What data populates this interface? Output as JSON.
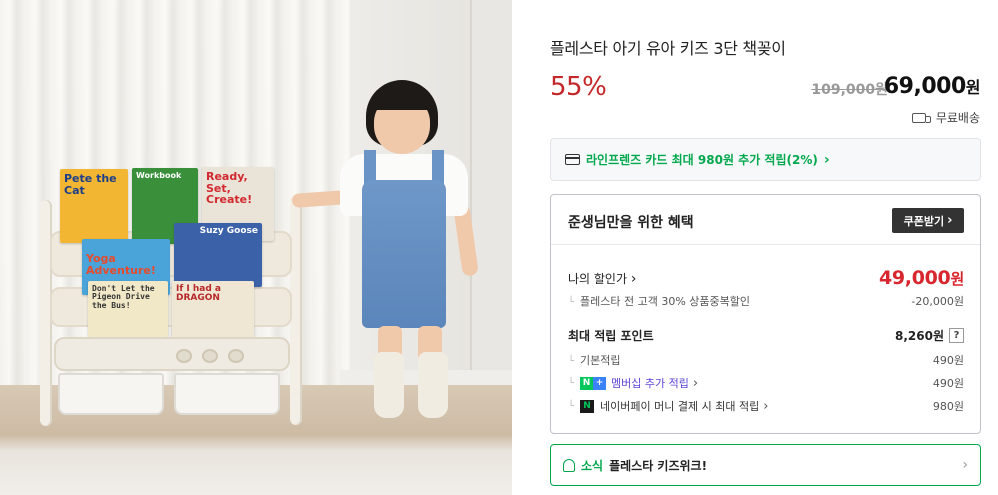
{
  "product": {
    "title": "플레스타 아기 유아 키즈 3단 책꽂이",
    "discount_rate": "55%",
    "original_price": "109,000원",
    "sale_price_number": "69,000",
    "sale_price_unit": "원",
    "shipping": "무료배송",
    "icons": {
      "shipping": "truck-icon"
    }
  },
  "card_promo": {
    "text": "라인프렌즈 카드 최대 980원 추가 적립(2%)",
    "chevron": "›",
    "icon": "credit-card-icon",
    "color": "#03a84e"
  },
  "benefit": {
    "title": "준생님만을 위한 혜택",
    "coupon_button": "쿠폰받기",
    "coupon_chevron": "›",
    "my_discount_label": "나의 할인가",
    "my_discount_chevron": "›",
    "my_discount_price_number": "49,000",
    "my_discount_price_unit": "원",
    "my_discount_detail_label": "플레스타 전 고객 30% 상품중복할인",
    "my_discount_detail_value": "-20,000원",
    "max_points_label": "최대 적립 포인트",
    "max_points_value": "8,260원",
    "help_mark": "?",
    "basic_label": "기본적립",
    "basic_value": "490원",
    "membership_badge_n": "N",
    "membership_badge_plus": "+",
    "membership_label": "멤버십 추가 적립",
    "membership_chevron": "›",
    "membership_value": "490원",
    "npay_badge": "N",
    "npay_label": "네이버페이 머니 결제 시 최대 적립",
    "npay_chevron": "›",
    "npay_value": "980원",
    "accent_red": "#d8262f",
    "accent_purple": "#5b46d6"
  },
  "news": {
    "tag": "소식",
    "message": "플레스타 키즈위크!",
    "chevron": "›",
    "icon": "bell-icon"
  },
  "photo": {
    "books": [
      {
        "title": "Pete the Cat",
        "color": "#f2b632"
      },
      {
        "title": "Workbook",
        "color": "#3a8f3a"
      },
      {
        "title": "Ready, Set, Create!",
        "color": "#e9e4d7"
      },
      {
        "title": "Yoga Adventure!",
        "color": "#4aa3d9"
      },
      {
        "title": "Suzy Goose",
        "color": "#3b62a8"
      },
      {
        "title": "Don't Let the Pigeon Drive the Bus!",
        "color": "#f1e8c8"
      },
      {
        "title": "If I had a DRAGON",
        "color": "#efe7d4"
      }
    ]
  }
}
